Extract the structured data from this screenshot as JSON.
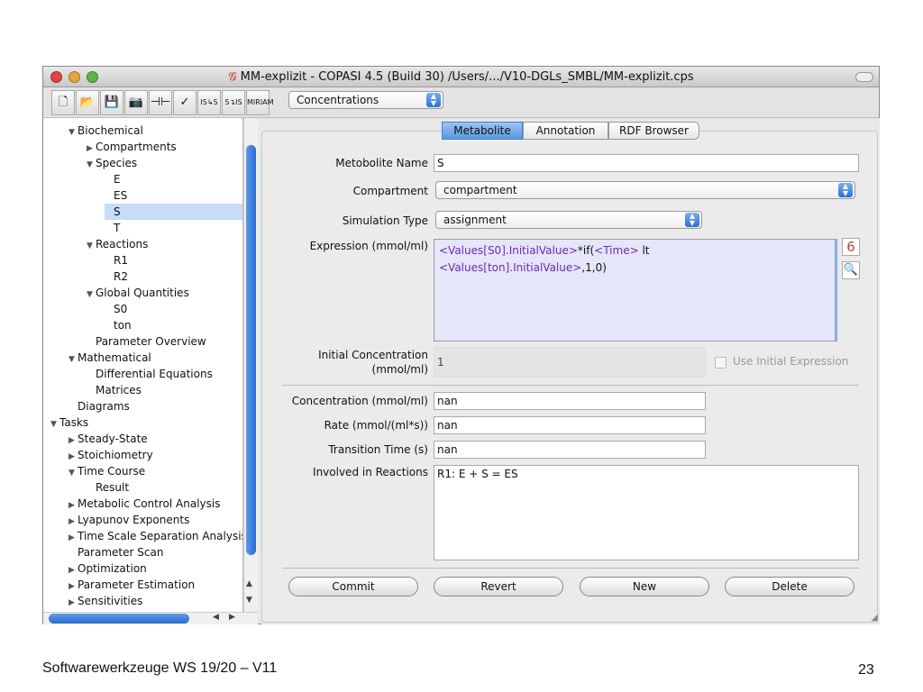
{
  "window": {
    "title": "MM-explizit - COPASI 4.5 (Build 30) /Users/.../V10-DGLs_SMBL/MM-explizit.cps"
  },
  "toolbar": {
    "buttons": [
      {
        "icon": "new-file-icon",
        "glyph": "🗋"
      },
      {
        "icon": "open-folder-icon",
        "glyph": "📂"
      },
      {
        "icon": "save-icon",
        "glyph": "💾"
      },
      {
        "icon": "camera-icon",
        "glyph": "📷"
      },
      {
        "icon": "circuit-icon",
        "glyph": "⊣⊢"
      },
      {
        "icon": "check-icon",
        "glyph": "✓"
      },
      {
        "icon": "is-to-s-icon",
        "glyph": "IS↳S"
      },
      {
        "icon": "s-to-is-icon",
        "glyph": "S↴IS"
      },
      {
        "icon": "miriam-icon",
        "glyph": "MIRIAM"
      }
    ],
    "view_select": "Concentrations"
  },
  "tree": [
    {
      "label": "Biochemical",
      "level": 1,
      "arrow": "down"
    },
    {
      "label": "Compartments",
      "level": 2,
      "arrow": "right"
    },
    {
      "label": "Species",
      "level": 2,
      "arrow": "down"
    },
    {
      "label": "E",
      "level": 3,
      "arrow": ""
    },
    {
      "label": "ES",
      "level": 3,
      "arrow": ""
    },
    {
      "label": "S",
      "level": 3,
      "arrow": "",
      "selected": true
    },
    {
      "label": "T",
      "level": 3,
      "arrow": ""
    },
    {
      "label": "Reactions",
      "level": 2,
      "arrow": "down"
    },
    {
      "label": "R1",
      "level": 3,
      "arrow": ""
    },
    {
      "label": "R2",
      "level": 3,
      "arrow": ""
    },
    {
      "label": "Global Quantities",
      "level": 2,
      "arrow": "down"
    },
    {
      "label": "S0",
      "level": 3,
      "arrow": ""
    },
    {
      "label": "ton",
      "level": 3,
      "arrow": ""
    },
    {
      "label": "Parameter Overview",
      "level": 2,
      "arrow": ""
    },
    {
      "label": "Mathematical",
      "level": 1,
      "arrow": "down"
    },
    {
      "label": "Differential Equations",
      "level": 2,
      "arrow": ""
    },
    {
      "label": "Matrices",
      "level": 2,
      "arrow": ""
    },
    {
      "label": "Diagrams",
      "level": 1,
      "arrow": ""
    },
    {
      "label": "Tasks",
      "level": 0,
      "arrow": "down"
    },
    {
      "label": "Steady-State",
      "level": 1,
      "arrow": "right"
    },
    {
      "label": "Stoichiometry",
      "level": 1,
      "arrow": "right"
    },
    {
      "label": "Time Course",
      "level": 1,
      "arrow": "down"
    },
    {
      "label": "Result",
      "level": 2,
      "arrow": ""
    },
    {
      "label": "Metabolic Control Analysis",
      "level": 1,
      "arrow": "right"
    },
    {
      "label": "Lyapunov Exponents",
      "level": 1,
      "arrow": "right"
    },
    {
      "label": "Time Scale Separation Analysis",
      "level": 1,
      "arrow": "right"
    },
    {
      "label": "Parameter Scan",
      "level": 1,
      "arrow": ""
    },
    {
      "label": "Optimization",
      "level": 1,
      "arrow": "right"
    },
    {
      "label": "Parameter Estimation",
      "level": 1,
      "arrow": "right"
    },
    {
      "label": "Sensitivities",
      "level": 1,
      "arrow": "right"
    }
  ],
  "tabs": [
    "Metabolite",
    "Annotation",
    "RDF Browser"
  ],
  "form": {
    "name_label": "Metobolite Name",
    "name_value": "S",
    "compartment_label": "Compartment",
    "compartment_value": "compartment",
    "simtype_label": "Simulation Type",
    "simtype_value": "assignment",
    "expression_label": "Expression (mmol/ml)",
    "expression_line1_a": "<Values[S0].InitialValue>",
    "expression_line1_b": "*if(",
    "expression_line1_c": "<Time>",
    "expression_line1_d": " lt",
    "expression_line2_a": "<Values[ton].InitialValue>",
    "expression_line2_b": ",1,0)",
    "initconc_label1": "Initial Concentration",
    "initconc_label2": "(mmol/ml)",
    "initconc_value": "1",
    "use_initial_expression": "Use Initial Expression",
    "conc_label": "Concentration (mmol/ml)",
    "conc_value": "nan",
    "rate_label": "Rate (mmol/(ml*s))",
    "rate_value": "nan",
    "transition_label": "Transition Time (s)",
    "transition_value": "nan",
    "reactions_label": "Involved in Reactions",
    "reactions_value": "R1: E + S = ES"
  },
  "buttons": {
    "commit": "Commit",
    "revert": "Revert",
    "new": "New",
    "delete": "Delete"
  },
  "footer": {
    "text": "Softwarewerkzeuge WS 19/20  –  V11",
    "page": "23"
  }
}
